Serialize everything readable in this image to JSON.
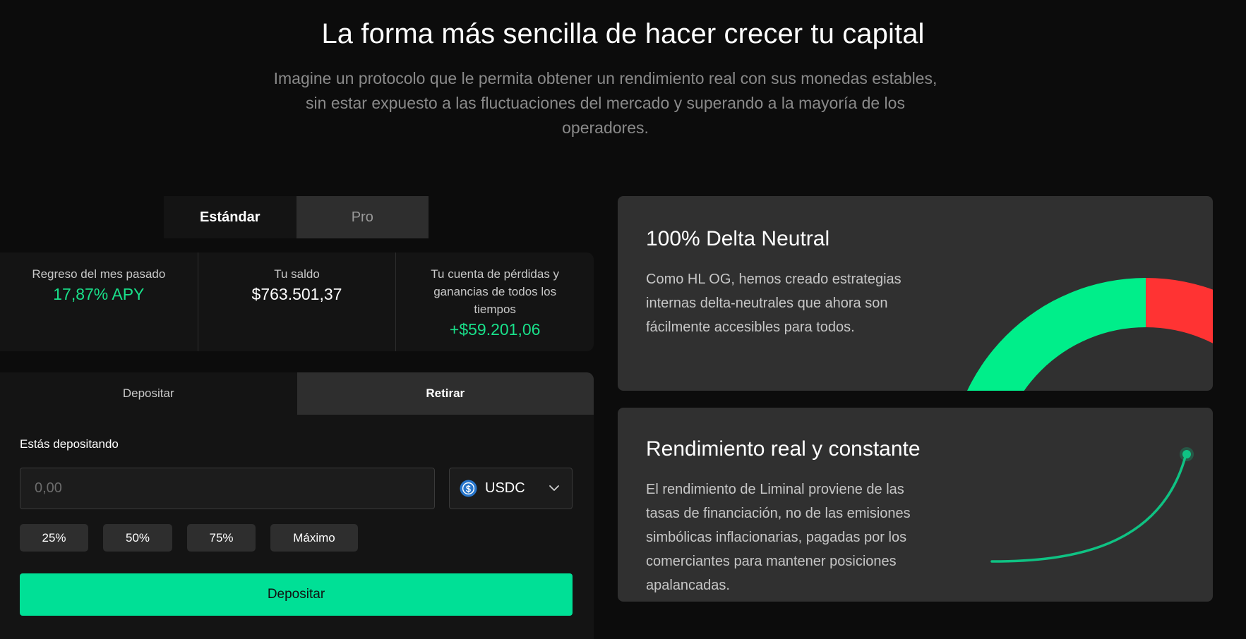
{
  "hero": {
    "title": "La forma más sencilla de hacer crecer tu capital",
    "subtitle": "Imagine un protocolo que le permita obtener un rendimiento real con sus monedas estables, sin estar expuesto a las fluctuaciones del mercado y superando a la mayoría de los operadores."
  },
  "mode_toggle": {
    "standard": "Estándar",
    "pro": "Pro"
  },
  "stats": [
    {
      "label": "Regreso del mes pasado",
      "value": "17,87% APY"
    },
    {
      "label": "Tu saldo",
      "value": "$763.501,37"
    },
    {
      "label": "Tu cuenta de pérdidas y ganancias de todos los tiempos",
      "value": "+$59.201,06"
    }
  ],
  "action_tabs": {
    "deposit": "Depositar",
    "withdraw": "Retirar"
  },
  "form": {
    "label": "Estás depositando",
    "amount_placeholder": "0,00",
    "token": "USDC",
    "percent_buttons": [
      "25%",
      "50%",
      "75%",
      "Máximo"
    ],
    "submit": "Depositar"
  },
  "cards": [
    {
      "title": "100% Delta Neutral",
      "text": "Como HL OG, hemos creado estrategias internas delta-neutrales que ahora son fácilmente accesibles para todos."
    },
    {
      "title": "Rendimiento real y constante",
      "text": "El rendimiento de Liminal proviene de las tasas de financiación, no de las emisiones simbólicas inflacionarias, pagadas por los comerciantes para mantener posiciones apalancadas."
    }
  ],
  "colors": {
    "accent": "#00e096",
    "positive": "#19e08a",
    "negative": "#ff3b3b",
    "usdc": "#2775ca"
  }
}
